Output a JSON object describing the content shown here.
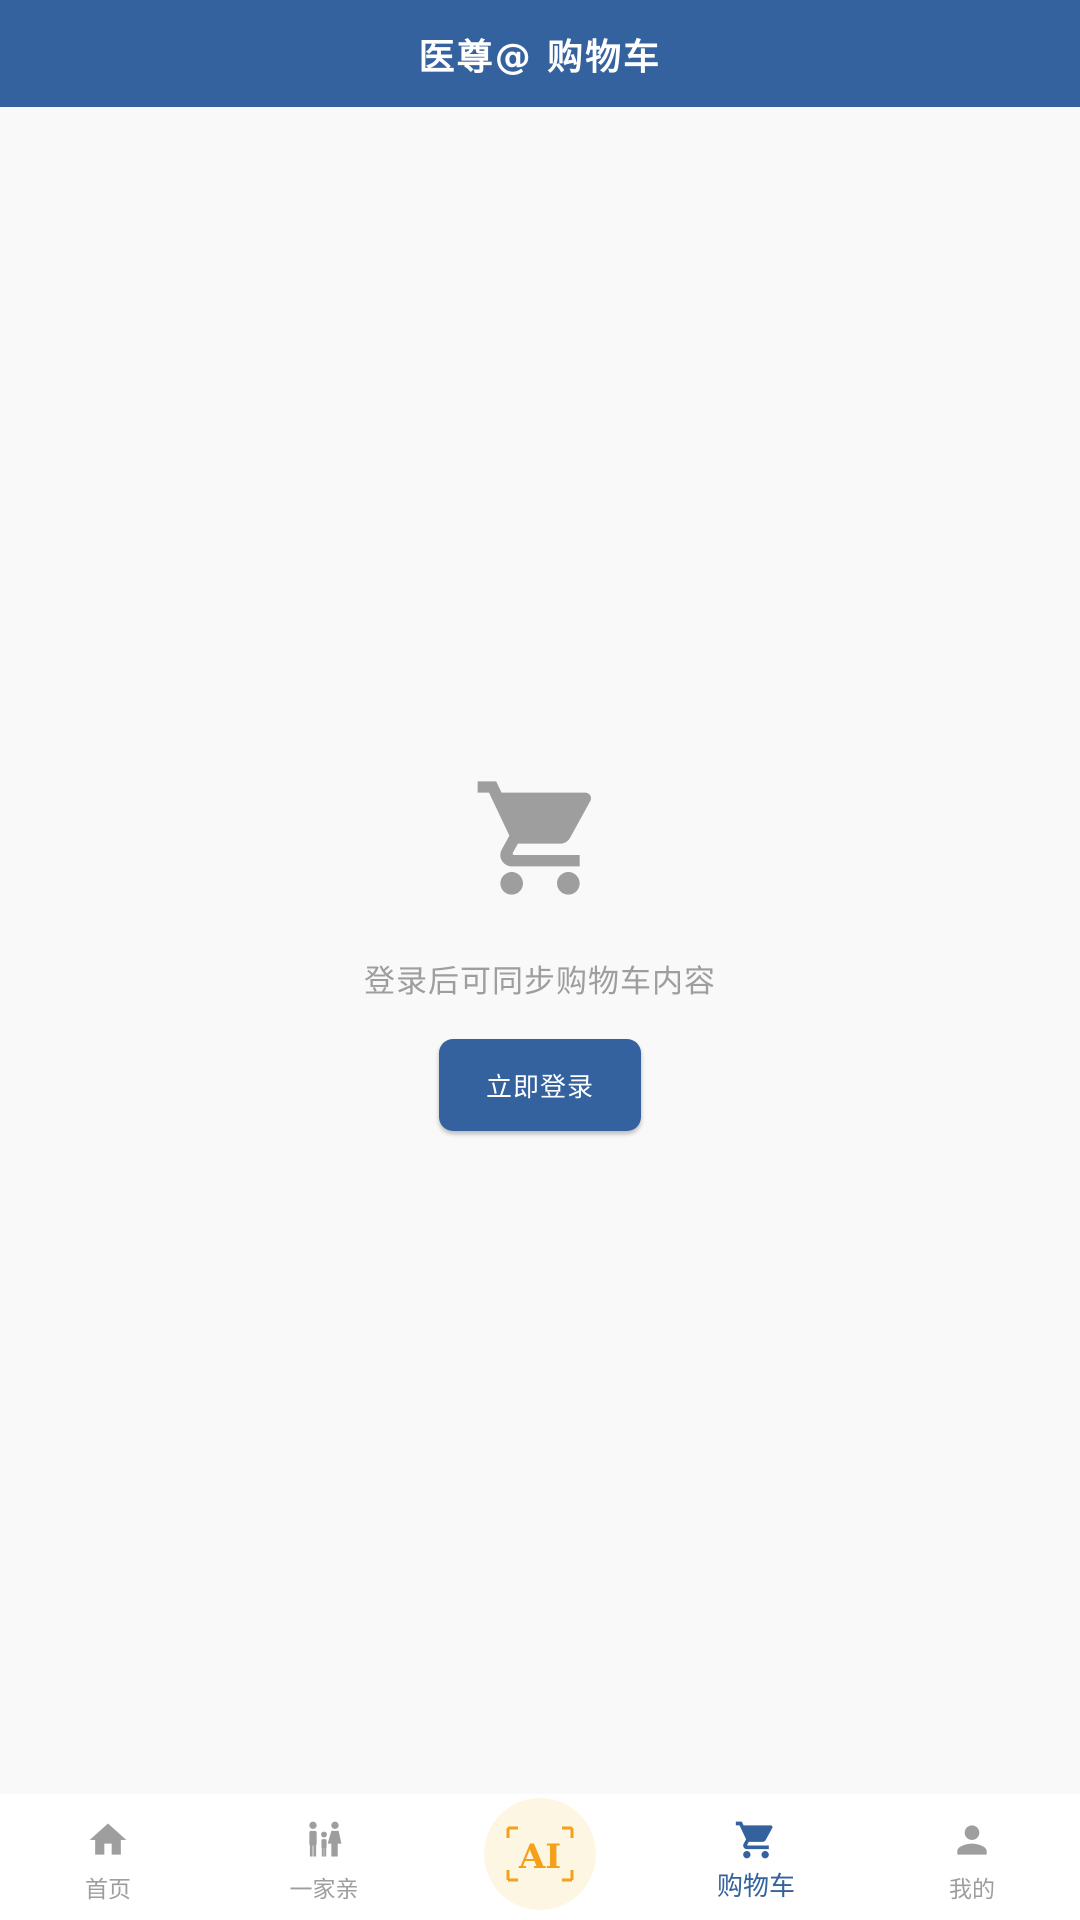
{
  "header": {
    "title": "医尊@ 购物车"
  },
  "empty_state": {
    "icon": "shopping-cart-icon",
    "message": "登录后可同步购物车内容",
    "login_button": "立即登录"
  },
  "tabbar": {
    "items": [
      {
        "label": "首页",
        "icon": "home-icon",
        "active": false
      },
      {
        "label": "一家亲",
        "icon": "family-icon",
        "active": false
      },
      {
        "label": "AI",
        "icon": "ai-icon",
        "active": false
      },
      {
        "label": "购物车",
        "icon": "shopping-cart-icon",
        "active": true
      },
      {
        "label": "我的",
        "icon": "person-icon",
        "active": false
      }
    ]
  },
  "colors": {
    "primary": "#34629e",
    "inactive": "#9e9e9e",
    "ai_accent": "#f5a01a",
    "ai_bg": "#fdf6e3",
    "background": "#f9f9f9"
  }
}
